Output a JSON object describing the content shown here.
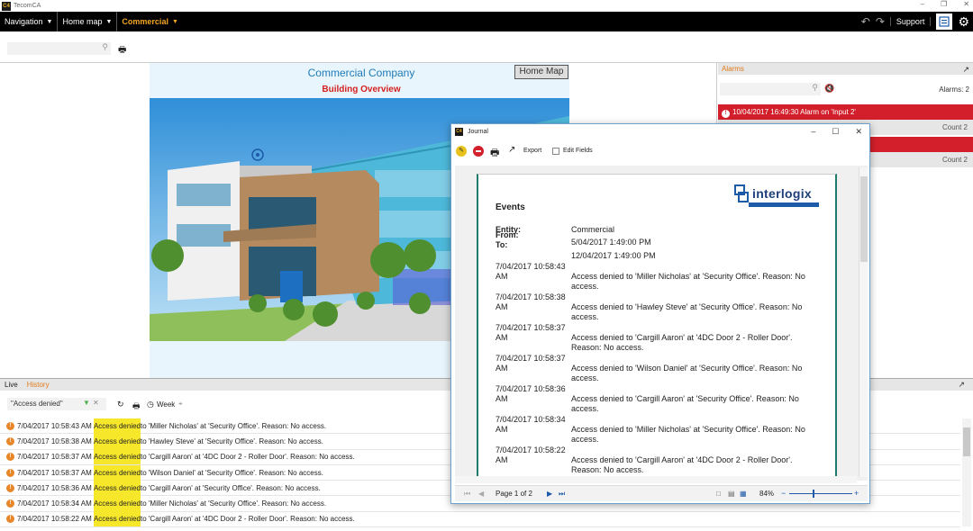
{
  "app": {
    "title": "TecomCA",
    "logo_text": "C4"
  },
  "nav": {
    "navigation": "Navigation",
    "home_map": "Home map",
    "commercial": "Commercial",
    "support": "Support"
  },
  "toolbar": {
    "search_placeholder": ""
  },
  "map": {
    "company_title": "Commercial Company",
    "building_title": "Building Overview",
    "home_map_button": "Home Map"
  },
  "alarms": {
    "header": "Alarms",
    "count_label": "Alarms: 2",
    "rows": [
      {
        "text": "10/04/2017 16:49:30 Alarm on 'Input 2'",
        "style": "red"
      },
      {
        "text": "Count 2",
        "style": "grey"
      },
      {
        "text": "",
        "style": "red"
      },
      {
        "text": "Count 2",
        "style": "grey"
      }
    ]
  },
  "history": {
    "tabs": {
      "live": "Live",
      "history": "History"
    },
    "filter_value": "\"Access denied\"",
    "week_label": "Week",
    "events": [
      {
        "time": "7/04/2017 10:58:43 AM",
        "highlight": "Access denied",
        "rest": " to 'Miller Nicholas' at 'Security Office'. Reason: No access."
      },
      {
        "time": "7/04/2017 10:58:38 AM",
        "highlight": "Access denied",
        "rest": " to 'Hawley Steve' at 'Security Office'. Reason: No access."
      },
      {
        "time": "7/04/2017 10:58:37 AM",
        "highlight": "Access denied",
        "rest": " to 'Cargill Aaron' at '4DC Door 2 - Roller Door'. Reason: No access."
      },
      {
        "time": "7/04/2017 10:58:37 AM",
        "highlight": "Access denied",
        "rest": " to 'Wilson Daniel' at 'Security Office'. Reason: No access."
      },
      {
        "time": "7/04/2017 10:58:36 AM",
        "highlight": "Access denied",
        "rest": " to 'Cargill Aaron' at 'Security Office'. Reason: No access."
      },
      {
        "time": "7/04/2017 10:58:34 AM",
        "highlight": "Access denied",
        "rest": " to 'Miller Nicholas' at 'Security Office'. Reason: No access."
      },
      {
        "time": "7/04/2017 10:58:22 AM",
        "highlight": "Access denied",
        "rest": " to 'Cargill Aaron' at '4DC Door 2 - Roller Door'. Reason: No access."
      }
    ]
  },
  "journal": {
    "title": "Journal",
    "export_label": "Export",
    "edit_fields_label": "Edit Fields",
    "events_title": "Events",
    "brand": "interlogix",
    "entity_label": "Entity:",
    "entity_value": "Commercial",
    "from_label": "From:",
    "from_value": "5/04/2017 1:49:00 PM",
    "to_label": "To:",
    "to_value": "12/04/2017 1:49:00 PM",
    "entries": [
      {
        "time": "7/04/2017 10:58:43 AM",
        "desc": "Access denied to 'Miller Nicholas' at 'Security Office'. Reason: No access."
      },
      {
        "time": "7/04/2017 10:58:38 AM",
        "desc": "Access denied to 'Hawley Steve' at 'Security Office'. Reason: No access."
      },
      {
        "time": "7/04/2017 10:58:37 AM",
        "desc": "Access denied to 'Cargill Aaron' at '4DC Door 2 - Roller Door'. Reason: No access."
      },
      {
        "time": "7/04/2017 10:58:37 AM",
        "desc": "Access denied to 'Wilson Daniel' at 'Security Office'. Reason: No access."
      },
      {
        "time": "7/04/2017 10:58:36 AM",
        "desc": "Access denied to 'Cargill Aaron' at 'Security Office'. Reason: No access."
      },
      {
        "time": "7/04/2017 10:58:34 AM",
        "desc": "Access denied to 'Miller Nicholas' at 'Security Office'. Reason: No access."
      },
      {
        "time": "7/04/2017 10:58:22 AM",
        "desc": "Access denied to 'Cargill Aaron' at '4DC Door 2 - Roller Door'. Reason: No access."
      }
    ],
    "page_label": "Page 1 of 2",
    "zoom": "84%"
  }
}
